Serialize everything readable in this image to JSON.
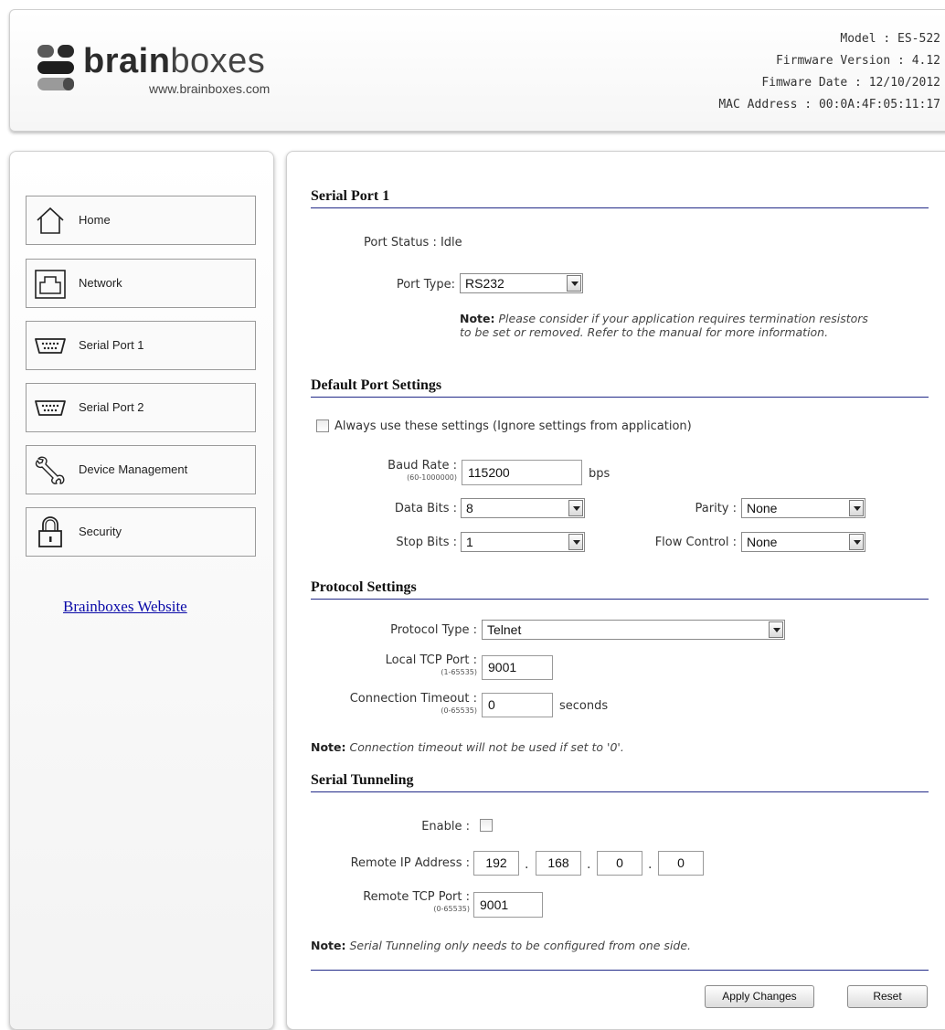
{
  "header": {
    "logo": {
      "bold": "brain",
      "light": "boxes",
      "url": "www.brainboxes.com"
    },
    "info": [
      {
        "key": "Model",
        "value": "ES-522"
      },
      {
        "key": "Firmware Version",
        "value": "4.12"
      },
      {
        "key": "Fimware Date",
        "value": "12/10/2012"
      },
      {
        "key": "MAC Address",
        "value": "00:0A:4F:05:11:17"
      }
    ]
  },
  "sidebar": {
    "items": [
      {
        "label": "Home",
        "icon": "home-icon"
      },
      {
        "label": "Network",
        "icon": "network-icon"
      },
      {
        "label": "Serial Port 1",
        "icon": "serial-port-icon"
      },
      {
        "label": "Serial Port 2",
        "icon": "serial-port-icon"
      },
      {
        "label": "Device Management",
        "icon": "wrench-icon"
      },
      {
        "label": "Security",
        "icon": "padlock-icon"
      }
    ],
    "website_link": "Brainboxes Website"
  },
  "main": {
    "serial_port": {
      "title": "Serial Port 1",
      "port_status_label": "Port Status : Idle",
      "port_type_label": "Port Type:",
      "port_type_value": "RS232",
      "note_bold": "Note:",
      "note_text": "Please consider if your application requires termination resistors to be set or removed. Refer to the manual for more information."
    },
    "default_settings": {
      "title": "Default Port Settings",
      "always_use_label": "Always use these settings (Ignore settings from application)",
      "baud_label": "Baud Rate :",
      "baud_range": "(60-1000000)",
      "baud_value": "115200",
      "baud_unit": "bps",
      "data_bits_label": "Data Bits :",
      "data_bits_value": "8",
      "parity_label": "Parity :",
      "parity_value": "None",
      "stop_bits_label": "Stop Bits :",
      "stop_bits_value": "1",
      "flow_control_label": "Flow Control :",
      "flow_control_value": "None"
    },
    "protocol": {
      "title": "Protocol Settings",
      "type_label": "Protocol Type :",
      "type_value": "Telnet",
      "local_port_label": "Local TCP Port :",
      "local_port_range": "(1-65535)",
      "local_port_value": "9001",
      "timeout_label": "Connection Timeout :",
      "timeout_range": "(0-65535)",
      "timeout_value": "0",
      "timeout_unit": "seconds",
      "note_bold": "Note:",
      "note_text": "Connection timeout will not be used if set to '0'."
    },
    "tunneling": {
      "title": "Serial Tunneling",
      "enable_label": "Enable :",
      "remote_ip_label": "Remote IP Address :",
      "ip": [
        "192",
        "168",
        "0",
        "0"
      ],
      "ip_sep": ".",
      "remote_port_label": "Remote TCP Port :",
      "remote_port_range": "(0-65535)",
      "remote_port_value": "9001",
      "note_bold": "Note:",
      "note_text": "Serial Tunneling only needs to be configured from one side."
    },
    "buttons": {
      "apply": "Apply Changes",
      "reset": "Reset"
    }
  }
}
